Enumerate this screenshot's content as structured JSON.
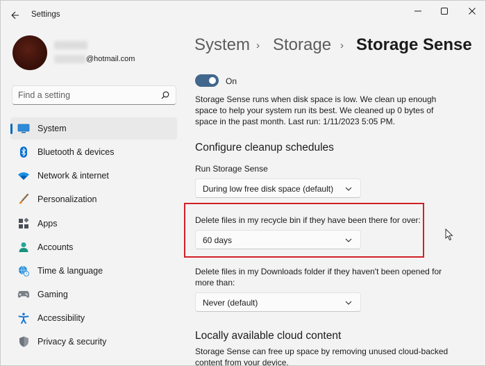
{
  "window": {
    "title": "Settings",
    "controls": [
      "minimize",
      "maximize",
      "close"
    ]
  },
  "profile": {
    "email_domain": "@hotmail.com"
  },
  "search": {
    "placeholder": "Find a setting"
  },
  "sidebar": {
    "items": [
      {
        "label": "System",
        "icon": "system-icon",
        "selected": true
      },
      {
        "label": "Bluetooth & devices",
        "icon": "bluetooth-icon"
      },
      {
        "label": "Network & internet",
        "icon": "wifi-icon"
      },
      {
        "label": "Personalization",
        "icon": "brush-icon"
      },
      {
        "label": "Apps",
        "icon": "apps-icon"
      },
      {
        "label": "Accounts",
        "icon": "person-icon"
      },
      {
        "label": "Time & language",
        "icon": "globe-clock-icon"
      },
      {
        "label": "Gaming",
        "icon": "gamepad-icon"
      },
      {
        "label": "Accessibility",
        "icon": "accessibility-icon"
      },
      {
        "label": "Privacy & security",
        "icon": "shield-icon"
      }
    ]
  },
  "breadcrumb": {
    "parts": [
      "System",
      "Storage"
    ],
    "current": "Storage Sense",
    "separator": "›"
  },
  "storage_sense": {
    "toggle_state": "On",
    "enabled": true,
    "description": "Storage Sense runs when disk space is low. We clean up enough space to help your system run its best. We cleaned up 0 bytes of space in the past month. Last run: 1/11/2023 5:05 PM."
  },
  "cleanup": {
    "heading": "Configure cleanup schedules",
    "run_label": "Run Storage Sense",
    "run_value": "During low free disk space (default)",
    "recycle_label": "Delete files in my recycle bin if they have been there for over:",
    "recycle_value": "60 days",
    "downloads_label": "Delete files in my Downloads folder if they haven't been opened for more than:",
    "downloads_value": "Never (default)"
  },
  "cloud": {
    "heading": "Locally available cloud content",
    "description": "Storage Sense can free up space by removing unused cloud-backed content from your device."
  },
  "colors": {
    "accent": "#0067c0",
    "toggle_on": "#41678c",
    "highlight": "#d21f26",
    "background": "#f3f3f3"
  }
}
